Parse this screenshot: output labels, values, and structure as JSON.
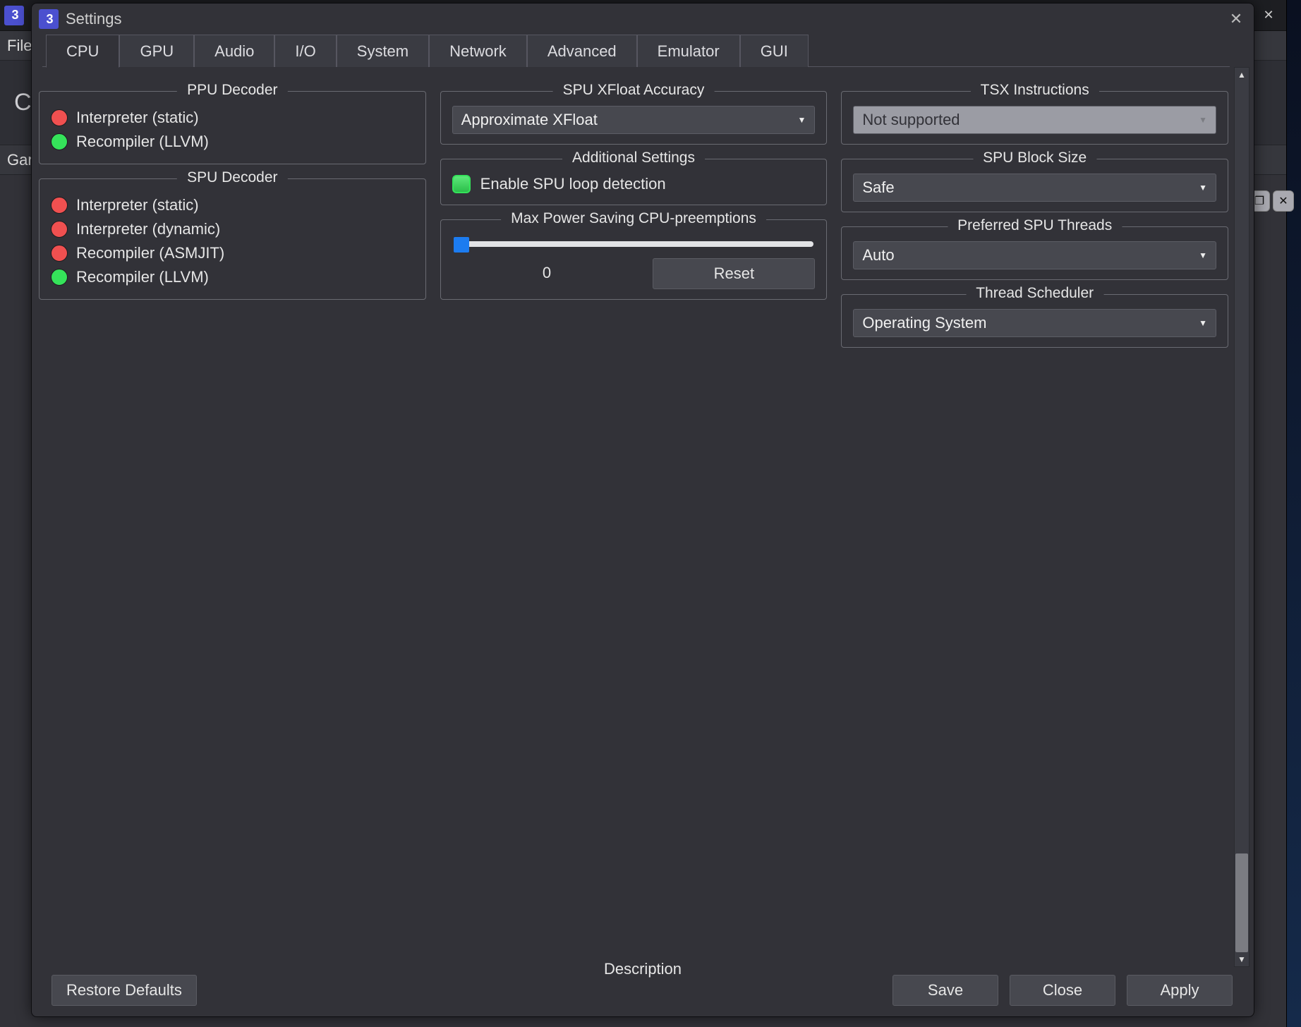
{
  "mainWindow": {
    "menubarFirstItem": "File",
    "gamelistHeader": "Gar",
    "toolbarPartial": "C"
  },
  "dialog": {
    "title": "Settings",
    "tabs": [
      "CPU",
      "GPU",
      "Audio",
      "I/O",
      "System",
      "Network",
      "Advanced",
      "Emulator",
      "GUI"
    ],
    "activeTab": "CPU",
    "descriptionLabel": "Description",
    "footer": {
      "restore": "Restore Defaults",
      "save": "Save",
      "close": "Close",
      "apply": "Apply"
    }
  },
  "cpu": {
    "ppu": {
      "legend": "PPU Decoder",
      "options": [
        "Interpreter (static)",
        "Recompiler (LLVM)"
      ],
      "selected": 1
    },
    "spu": {
      "legend": "SPU Decoder",
      "options": [
        "Interpreter (static)",
        "Interpreter (dynamic)",
        "Recompiler (ASMJIT)",
        "Recompiler (LLVM)"
      ],
      "selected": 3
    },
    "xfloat": {
      "legend": "SPU XFloat Accuracy",
      "value": "Approximate XFloat"
    },
    "additional": {
      "legend": "Additional Settings",
      "loopDetectLabel": "Enable SPU loop detection",
      "loopDetectChecked": true
    },
    "preempt": {
      "legend": "Max Power Saving CPU-preemptions",
      "value": "0",
      "resetLabel": "Reset"
    },
    "tsx": {
      "legend": "TSX Instructions",
      "value": "Not supported"
    },
    "blockSize": {
      "legend": "SPU Block Size",
      "value": "Safe"
    },
    "spuThreads": {
      "legend": "Preferred SPU Threads",
      "value": "Auto"
    },
    "scheduler": {
      "legend": "Thread Scheduler",
      "value": "Operating System"
    }
  }
}
